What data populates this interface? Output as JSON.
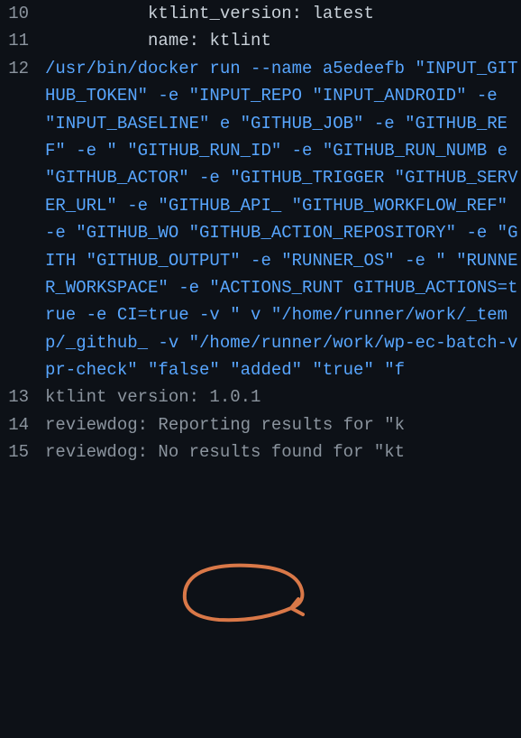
{
  "lines": [
    {
      "number": "10",
      "indent": "          ",
      "text": "ktlint_version: latest",
      "color": "white"
    },
    {
      "number": "11",
      "indent": "          ",
      "text": "name: ktlint",
      "color": "white"
    },
    {
      "number": "12",
      "indent": "",
      "text": "/usr/bin/docker run --name a5edeefb \"INPUT_GITHUB_TOKEN\" -e \"INPUT_REPO \"INPUT_ANDROID\" -e \"INPUT_BASELINE\" e \"GITHUB_JOB\" -e \"GITHUB_REF\" -e \" \"GITHUB_RUN_ID\" -e \"GITHUB_RUN_NUMB e \"GITHUB_ACTOR\" -e \"GITHUB_TRIGGER \"GITHUB_SERVER_URL\" -e \"GITHUB_API_ \"GITHUB_WORKFLOW_REF\" -e \"GITHUB_WO \"GITHUB_ACTION_REPOSITORY\" -e \"GITH \"GITHUB_OUTPUT\" -e \"RUNNER_OS\" -e \" \"RUNNER_WORKSPACE\" -e \"ACTIONS_RUNT GITHUB_ACTIONS=true -e CI=true -v \" v \"/home/runner/work/_temp/_github_ -v \"/home/runner/work/wp-ec-batch-v pr-check\" \"false\" \"added\" \"true\" \"f",
      "color": "blue"
    },
    {
      "number": "13",
      "indent": "",
      "text": "ktlint version: 1.0.1",
      "color": "gray"
    },
    {
      "number": "14",
      "indent": "",
      "text": "reviewdog: Reporting results for \"k",
      "color": "gray"
    },
    {
      "number": "15",
      "indent": "",
      "text": "reviewdog: No results found for \"kt",
      "color": "gray"
    }
  ],
  "annotation": {
    "type": "circle",
    "color": "#d97848",
    "target": "1.0.1"
  }
}
